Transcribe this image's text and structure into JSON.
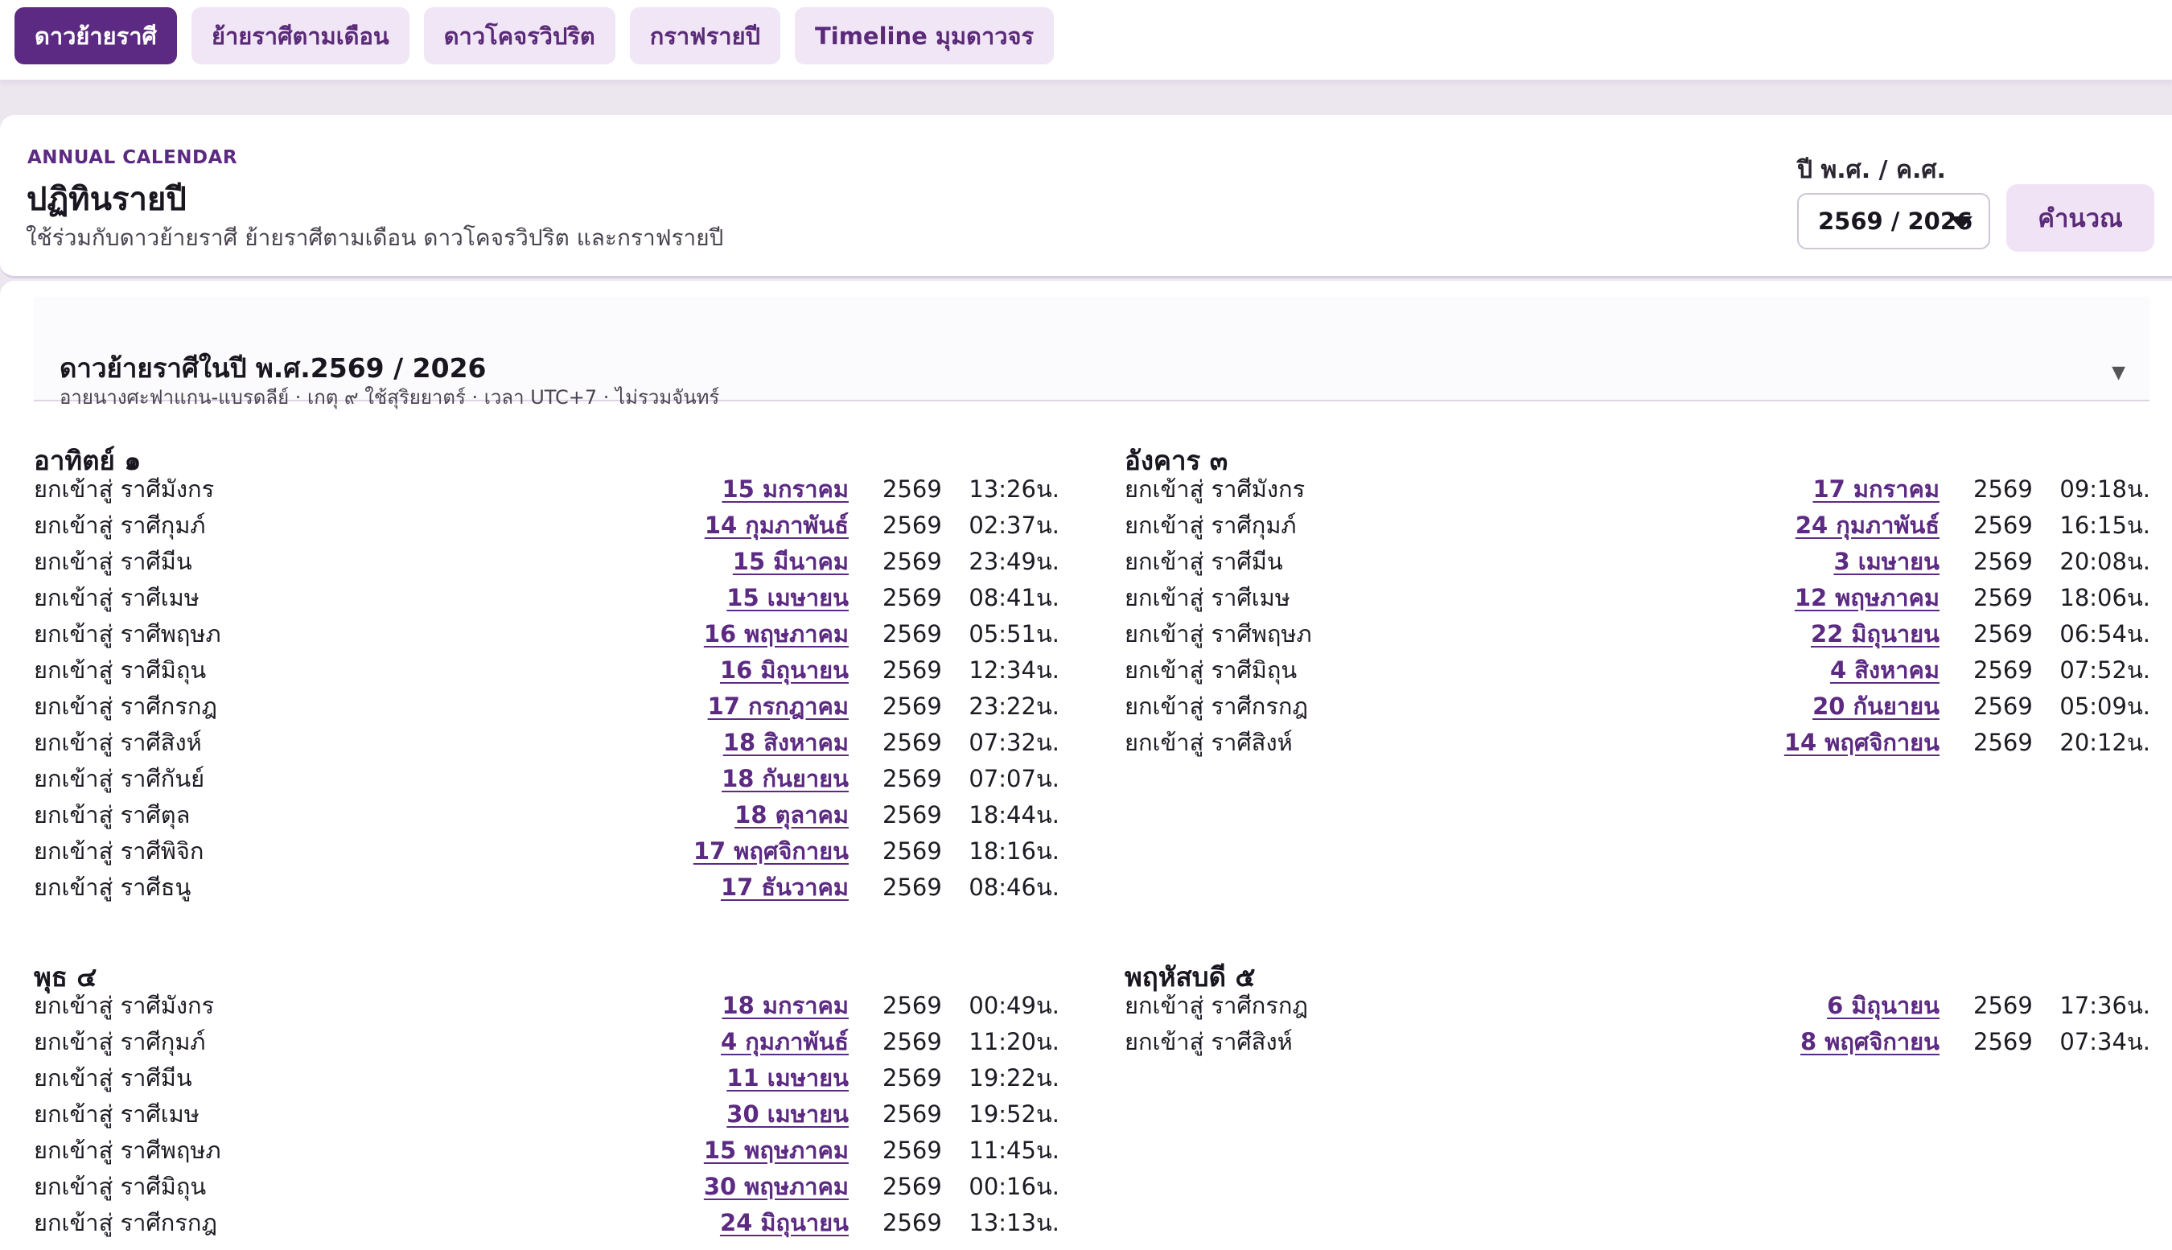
{
  "tabs": [
    {
      "label": "ดาวย้ายราศี",
      "active": true
    },
    {
      "label": "ย้ายราศีตามเดือน",
      "active": false
    },
    {
      "label": "ดาวโคจรวิปริต",
      "active": false
    },
    {
      "label": "กราฟรายปี",
      "active": false
    },
    {
      "label": "Timeline มุมดาวจร",
      "active": false
    }
  ],
  "calendar": {
    "kicker": "ANNUAL CALENDAR",
    "title": "ปฏิทินรายปี",
    "subtitle": "ใช้ร่วมกับดาวย้ายราศี ย้ายราศีตามเดือน ดาวโคจรวิปริต และกราฟรายปี",
    "year_label": "ปี พ.ศ. / ค.ศ.",
    "year_value": "2569 / 2026",
    "calc_button": "คำนวณ"
  },
  "section": {
    "title": "ดาวย้ายราศีในปี พ.ศ.2569 / 2026",
    "subtitle": "อายนางศะฟาแกน-แบรดลีย์ · เกตุ ๙ ใช้สุริยยาตร์ · เวลา UTC+7 · ไม่รวมจันทร์",
    "toggle_icon": "▼"
  },
  "planets": [
    {
      "name": "อาทิตย์ ๑",
      "rows": [
        {
          "label": "ยกเข้าสู่ ราศีมังกร",
          "date": "15 มกราคม",
          "year": "2569",
          "time": "13:26น."
        },
        {
          "label": "ยกเข้าสู่ ราศีกุมภ์",
          "date": "14 กุมภาพันธ์",
          "year": "2569",
          "time": "02:37น."
        },
        {
          "label": "ยกเข้าสู่ ราศีมีน",
          "date": "15 มีนาคม",
          "year": "2569",
          "time": "23:49น."
        },
        {
          "label": "ยกเข้าสู่ ราศีเมษ",
          "date": "15 เมษายน",
          "year": "2569",
          "time": "08:41น."
        },
        {
          "label": "ยกเข้าสู่ ราศีพฤษภ",
          "date": "16 พฤษภาคม",
          "year": "2569",
          "time": "05:51น."
        },
        {
          "label": "ยกเข้าสู่ ราศีมิถุน",
          "date": "16 มิถุนายน",
          "year": "2569",
          "time": "12:34น."
        },
        {
          "label": "ยกเข้าสู่ ราศีกรกฎ",
          "date": "17 กรกฎาคม",
          "year": "2569",
          "time": "23:22น."
        },
        {
          "label": "ยกเข้าสู่ ราศีสิงห์",
          "date": "18 สิงหาคม",
          "year": "2569",
          "time": "07:32น."
        },
        {
          "label": "ยกเข้าสู่ ราศีกันย์",
          "date": "18 กันยายน",
          "year": "2569",
          "time": "07:07น."
        },
        {
          "label": "ยกเข้าสู่ ราศีตุล",
          "date": "18 ตุลาคม",
          "year": "2569",
          "time": "18:44น."
        },
        {
          "label": "ยกเข้าสู่ ราศีพิจิก",
          "date": "17 พฤศจิกายน",
          "year": "2569",
          "time": "18:16น."
        },
        {
          "label": "ยกเข้าสู่ ราศีธนู",
          "date": "17 ธันวาคม",
          "year": "2569",
          "time": "08:46น."
        }
      ]
    },
    {
      "name": "อังคาร ๓",
      "rows": [
        {
          "label": "ยกเข้าสู่ ราศีมังกร",
          "date": "17 มกราคม",
          "year": "2569",
          "time": "09:18น."
        },
        {
          "label": "ยกเข้าสู่ ราศีกุมภ์",
          "date": "24 กุมภาพันธ์",
          "year": "2569",
          "time": "16:15น."
        },
        {
          "label": "ยกเข้าสู่ ราศีมีน",
          "date": "3 เมษายน",
          "year": "2569",
          "time": "20:08น."
        },
        {
          "label": "ยกเข้าสู่ ราศีเมษ",
          "date": "12 พฤษภาคม",
          "year": "2569",
          "time": "18:06น."
        },
        {
          "label": "ยกเข้าสู่ ราศีพฤษภ",
          "date": "22 มิถุนายน",
          "year": "2569",
          "time": "06:54น."
        },
        {
          "label": "ยกเข้าสู่ ราศีมิถุน",
          "date": "4 สิงหาคม",
          "year": "2569",
          "time": "07:52น."
        },
        {
          "label": "ยกเข้าสู่ ราศีกรกฎ",
          "date": "20 กันยายน",
          "year": "2569",
          "time": "05:09น."
        },
        {
          "label": "ยกเข้าสู่ ราศีสิงห์",
          "date": "14 พฤศจิกายน",
          "year": "2569",
          "time": "20:12น."
        }
      ]
    },
    {
      "name": "พุธ ๔",
      "rows": [
        {
          "label": "ยกเข้าสู่ ราศีมังกร",
          "date": "18 มกราคม",
          "year": "2569",
          "time": "00:49น."
        },
        {
          "label": "ยกเข้าสู่ ราศีกุมภ์",
          "date": "4 กุมภาพันธ์",
          "year": "2569",
          "time": "11:20น."
        },
        {
          "label": "ยกเข้าสู่ ราศีมีน",
          "date": "11 เมษายน",
          "year": "2569",
          "time": "19:22น."
        },
        {
          "label": "ยกเข้าสู่ ราศีเมษ",
          "date": "30 เมษายน",
          "year": "2569",
          "time": "19:52น."
        },
        {
          "label": "ยกเข้าสู่ ราศีพฤษภ",
          "date": "15 พฤษภาคม",
          "year": "2569",
          "time": "11:45น."
        },
        {
          "label": "ยกเข้าสู่ ราศีมิถุน",
          "date": "30 พฤษภาคม",
          "year": "2569",
          "time": "00:16น."
        },
        {
          "label": "ยกเข้าสู่ ราศีกรกฎ",
          "date": "24 มิถุนายน",
          "year": "2569",
          "time": "13:13น."
        }
      ]
    },
    {
      "name": "พฤหัสบดี ๕",
      "rows": [
        {
          "label": "ยกเข้าสู่ ราศีกรกฎ",
          "date": "6 มิถุนายน",
          "year": "2569",
          "time": "17:36น."
        },
        {
          "label": "ยกเข้าสู่ ราศีสิงห์",
          "date": "8 พฤศจิกายน",
          "year": "2569",
          "time": "07:34น."
        }
      ]
    }
  ]
}
